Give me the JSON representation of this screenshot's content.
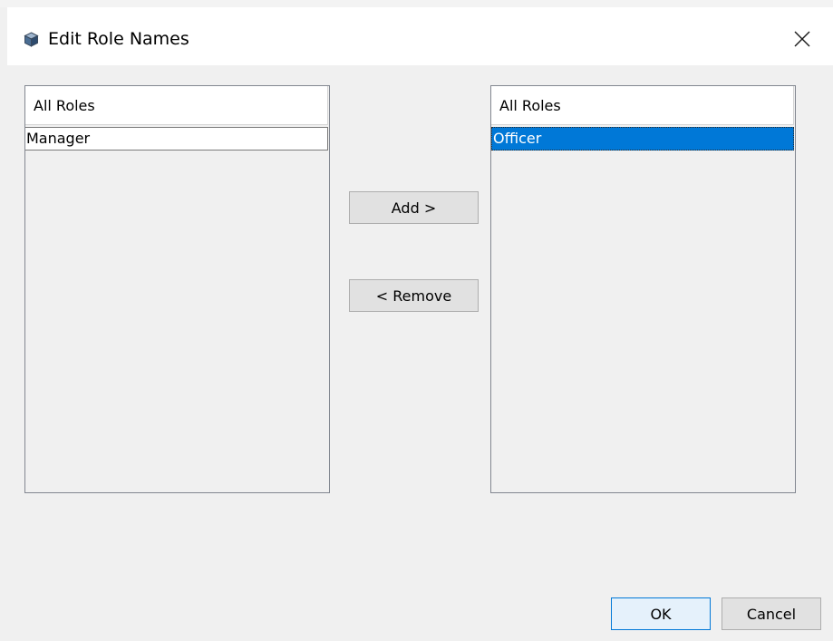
{
  "window": {
    "title": "Edit Role Names",
    "icon": "cube-icon",
    "close_icon": "close-icon"
  },
  "left_list": {
    "header": "All Roles",
    "items": [
      {
        "label": "Manager",
        "selected": false
      }
    ]
  },
  "right_list": {
    "header": "All Roles",
    "items": [
      {
        "label": "Officer",
        "selected": true
      }
    ]
  },
  "buttons": {
    "add_label": "Add >",
    "remove_label": "< Remove",
    "ok_label": "OK",
    "cancel_label": "Cancel"
  },
  "colors": {
    "selection": "#0078d7",
    "default_button_border": "#0078d7"
  }
}
